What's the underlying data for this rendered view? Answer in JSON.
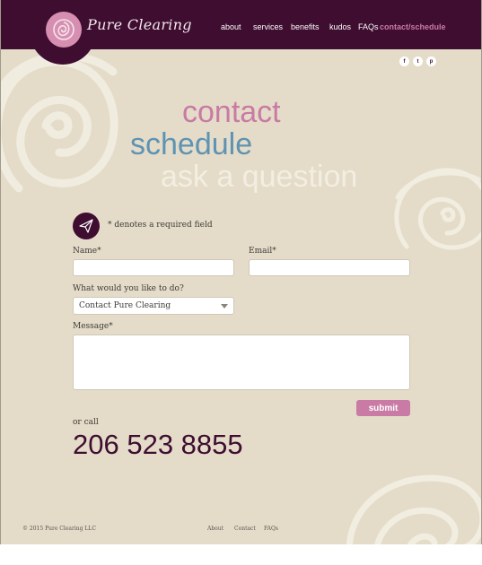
{
  "brand": {
    "name": "Pure Clearing"
  },
  "nav": {
    "items": [
      {
        "label": "about"
      },
      {
        "label": "services"
      },
      {
        "label": "benefits"
      },
      {
        "label": "kudos"
      },
      {
        "label": "FAQs"
      },
      {
        "label": "contact/schedule",
        "active": true
      }
    ]
  },
  "social": [
    {
      "icon": "facebook-icon",
      "glyph": "f"
    },
    {
      "icon": "twitter-icon",
      "glyph": "t"
    },
    {
      "icon": "pinterest-icon",
      "glyph": "p"
    }
  ],
  "hero": {
    "line1": "contact",
    "line2": "schedule",
    "line3": "ask a question"
  },
  "form": {
    "icon": "paper-plane-icon",
    "required_note": "* denotes a required field",
    "name_label": "Name*",
    "name_value": "",
    "email_label": "Email*",
    "email_value": "",
    "todo_label": "What would you like to do?",
    "todo_selected": "Contact Pure Clearing",
    "message_label": "Message*",
    "message_value": "",
    "submit_label": "submit"
  },
  "call": {
    "or_call": "or call",
    "phone": "206 523 8855"
  },
  "footer": {
    "copyright": "© 2015 Pure Clearing LLC",
    "links": [
      {
        "label": "About"
      },
      {
        "label": "Contact"
      },
      {
        "label": "FAQs"
      }
    ]
  },
  "colors": {
    "header_bg": "#3e0d30",
    "page_bg": "#e4dcc8",
    "accent_pink": "#c97aa5",
    "accent_blue": "#5e93b3",
    "hero_cream": "#f3eee2"
  }
}
